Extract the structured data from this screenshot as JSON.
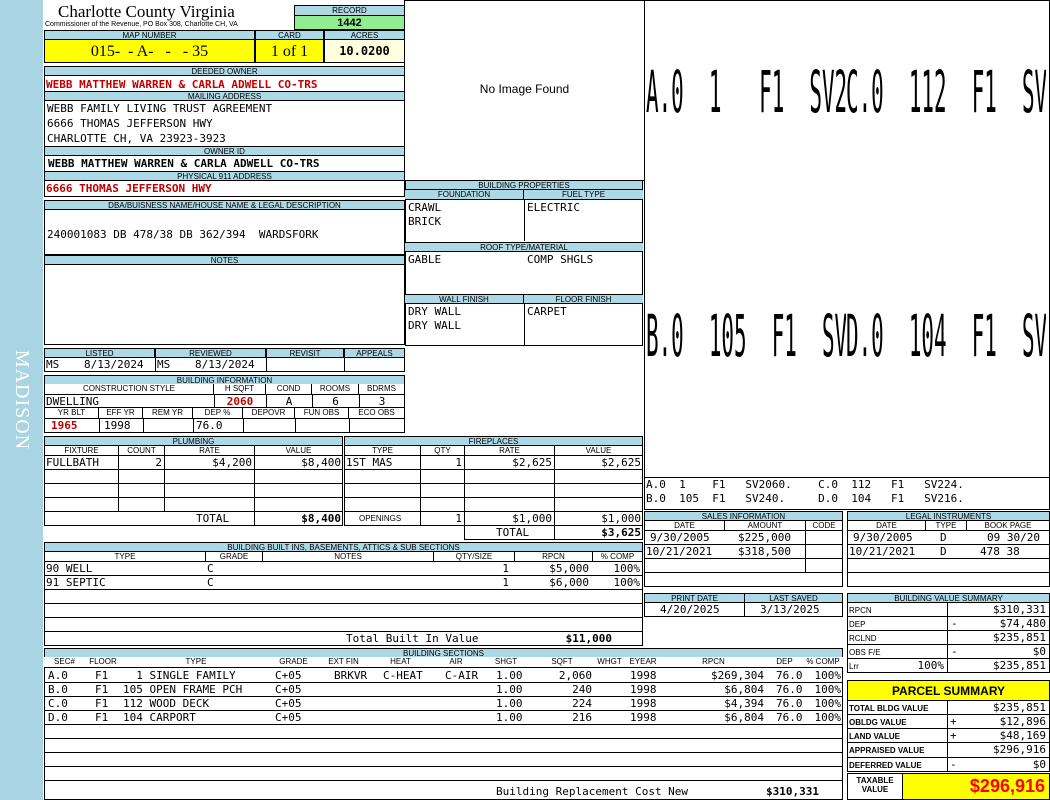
{
  "sidebar": {
    "district": "MADISON"
  },
  "county": {
    "title": "Charlotte County Virginia",
    "subtitle": "Commissioner of the Revenue, PO Box 308, Charlotte CH, VA"
  },
  "record": {
    "label": "RECORD",
    "value": "1442"
  },
  "map": {
    "map_label": "MAP NUMBER",
    "map_number": "015-  - A-   -   - 35",
    "card_label": "CARD",
    "card_value": "1 of 1",
    "acres_label": "ACRES",
    "acres_value": "10.0200"
  },
  "deeded_owner": {
    "label": "DEEDED OWNER",
    "value": "WEBB MATTHEW WARREN & CARLA ADWELL CO-TRS"
  },
  "mailing": {
    "label": "MAILING ADDRESS",
    "line1": "WEBB FAMILY LIVING TRUST AGREEMENT",
    "line2": "6666 THOMAS JEFFERSON HWY",
    "line3": "CHARLOTTE CH, VA 23923-3923"
  },
  "owner_id": {
    "label": "OWNER ID",
    "value": "WEBB MATTHEW WARREN & CARLA ADWELL CO-TRS"
  },
  "physical": {
    "label": "PHYSICAL 911 ADDRESS",
    "value": "6666 THOMAS JEFFERSON HWY"
  },
  "legal": {
    "label": "DBA/BUISNESS NAME/HOUSE NAME & LEGAL DESCRIPTION",
    "value": "240001083 DB 478/38 DB 362/394  WARDSFORK"
  },
  "notes": {
    "label": "NOTES",
    "value": ""
  },
  "photo": {
    "text": "No Image Found"
  },
  "listed": {
    "listed_label": "LISTED",
    "listed_by": "MS",
    "listed_date": "8/13/2024",
    "reviewed_label": "REVIEWED",
    "reviewed_by": "MS",
    "reviewed_date": "8/13/2024",
    "revisit_label": "REVISIT",
    "appeals_label": "APPEALS"
  },
  "building_info": {
    "label": "BUILDING INFORMATION",
    "h_style": "CONSTRUCTION STYLE",
    "h_sqft": "H SQFT",
    "h_cond": "COND",
    "h_rooms": "ROOMS",
    "h_bdrms": "BDRMS",
    "style": "DWELLING",
    "sqft": "2060",
    "cond": "A",
    "rooms": "6",
    "bdrms": "3",
    "h_yrblt": "YR BLT",
    "h_effyr": "EFF YR",
    "h_remyr": "REM YR",
    "h_dep": "DEP %",
    "h_depovr": "DEPOVR",
    "h_funobs": "FUN OBS",
    "h_ecoobs": "ECO OBS",
    "yrblt": "1965",
    "effyr": "1998",
    "remyr": "",
    "dep": "76.0",
    "depovr": "",
    "funobs": "",
    "ecoobs": ""
  },
  "building_props": {
    "label": "BUILDING PROPERTIES",
    "foundation_label": "FOUNDATION",
    "foundation_1": "CRAWL",
    "foundation_2": "BRICK",
    "fuel_label": "FUEL TYPE",
    "fuel": "ELECTRIC",
    "roof_label": "ROOF TYPE/MATERIAL",
    "roof_type": "GABLE",
    "roof_material": "COMP SHGLS",
    "wall_label": "WALL FINISH",
    "wall_1": "DRY WALL",
    "wall_2": "DRY WALL",
    "floor_label": "FLOOR FINISH",
    "floor": "CARPET"
  },
  "sketch": {
    "row1": [
      {
        "text": "A.0  1   F1  SV2060."
      },
      {
        "text": "C.0  112  F1  SV224."
      }
    ],
    "row2": [
      {
        "text": "B.0  105  F1  SV240."
      },
      {
        "text": "D.0  104  F1  SV216."
      }
    ],
    "legend_1": "A.0  1    F1   SV2060.    C.0  112   F1   SV224.",
    "legend_2": "B.0  105  F1   SV240.     D.0  104   F1   SV216."
  },
  "plumbing": {
    "label": "PLUMBING",
    "headers": [
      "FIXTURE",
      "COUNT",
      "RATE",
      "VALUE"
    ],
    "rows": [
      {
        "fixture": "FULLBATH",
        "count": "2",
        "rate": "$4,200",
        "value": "$8,400"
      }
    ],
    "total_label": "TOTAL",
    "total": "$8,400"
  },
  "fireplaces": {
    "label": "FIREPLACES",
    "headers": [
      "TYPE",
      "QTY",
      "RATE",
      "VALUE"
    ],
    "rows": [
      {
        "type": "1ST MAS",
        "qty": "1",
        "rate": "$2,625",
        "value": "$2,625"
      }
    ],
    "openings_label": "OPENINGS",
    "openings_qty": "1",
    "openings_rate": "$1,000",
    "openings_value": "$1,000",
    "total_label": "TOTAL",
    "total": "$3,625"
  },
  "sales": {
    "label": "SALES INFORMATION",
    "headers": [
      "DATE",
      "AMOUNT",
      "CODE"
    ],
    "rows": [
      {
        "date": "9/30/2005",
        "amount": "$225,000",
        "code": ""
      },
      {
        "date": "10/21/2021",
        "amount": "$318,500",
        "code": ""
      }
    ]
  },
  "legal_instruments": {
    "label": "LEGAL INSTRUMENTS",
    "headers": [
      "DATE",
      "TYPE",
      "BOOK PAGE"
    ],
    "rows": [
      {
        "date": "9/30/2005",
        "type": "D",
        "book": "09 30/20"
      },
      {
        "date": "10/21/2021",
        "type": "D",
        "book": "478 38"
      }
    ]
  },
  "print": {
    "print_label": "PRINT DATE",
    "print_date": "4/20/2025",
    "saved_label": "LAST SAVED",
    "saved_date": "3/13/2025"
  },
  "builtins": {
    "label": "BUILDING BUILT INS, BASEMENTS, ATTICS & SUB SECTIONS",
    "headers": [
      "TYPE",
      "GRADE",
      "NOTES",
      "QTY/SIZE",
      "RPCN",
      "% COMP"
    ],
    "rows": [
      {
        "type": "90 WELL",
        "grade": "C",
        "notes": "",
        "qty": "1",
        "rpcn": "$5,000",
        "comp": "100%"
      },
      {
        "type": "91 SEPTIC",
        "grade": "C",
        "notes": "",
        "qty": "1",
        "rpcn": "$6,000",
        "comp": "100%"
      }
    ],
    "total_label": "Total Built In Value",
    "total": "$11,000"
  },
  "value_summary": {
    "label": "BUILDING VALUE SUMMARY",
    "rows": [
      {
        "label": "RPCN",
        "sign": "",
        "value": "$310,331"
      },
      {
        "label": "DEP",
        "sign": "-",
        "value": "$74,480"
      },
      {
        "label": "RCLND",
        "sign": "",
        "value": "$235,851"
      },
      {
        "label": "OBS F/E",
        "sign": "-",
        "value": "$0"
      },
      {
        "label": "Lrr",
        "pct": "100%",
        "sign": "",
        "value": "$235,851"
      }
    ]
  },
  "sections": {
    "label": "BUILDING SECTIONS",
    "headers": [
      "SEC#",
      "FLOOR",
      "TYPE",
      "GRADE",
      "EXT FIN",
      "HEAT",
      "AIR",
      "SHGT",
      "SQFT",
      "WHGT",
      "EYEAR",
      "RPCN",
      "DEP",
      "% COMP"
    ],
    "rows": [
      {
        "sec": "A.0",
        "floor": "F1",
        "type": "  1 SINGLE FAMILY",
        "grade": "C+05",
        "ext": "BRKVR",
        "heat": "C-HEAT",
        "air": "C-AIR",
        "shgt": "1.00",
        "sqft": "2,060",
        "whgt": "",
        "eyear": "1998",
        "rpcn": "$269,304",
        "dep": "76.0",
        "comp": "100%"
      },
      {
        "sec": "B.0",
        "floor": "F1",
        "type": "105 OPEN FRAME PCH",
        "grade": "C+05",
        "ext": "",
        "heat": "",
        "air": "",
        "shgt": "1.00",
        "sqft": "240",
        "whgt": "",
        "eyear": "1998",
        "rpcn": "$6,804",
        "dep": "76.0",
        "comp": "100%"
      },
      {
        "sec": "C.0",
        "floor": "F1",
        "type": "112 WOOD DECK",
        "grade": "C+05",
        "ext": "",
        "heat": "",
        "air": "",
        "shgt": "1.00",
        "sqft": "224",
        "whgt": "",
        "eyear": "1998",
        "rpcn": "$4,394",
        "dep": "76.0",
        "comp": "100%"
      },
      {
        "sec": "D.0",
        "floor": "F1",
        "type": "104 CARPORT",
        "grade": "C+05",
        "ext": "",
        "heat": "",
        "air": "",
        "shgt": "1.00",
        "sqft": "216",
        "whgt": "",
        "eyear": "1998",
        "rpcn": "$6,804",
        "dep": "76.0",
        "comp": "100%"
      }
    ],
    "total_label": "Building Replacement Cost New",
    "total": "$310,331"
  },
  "parcel": {
    "label": "PARCEL SUMMARY",
    "rows": [
      {
        "label": "TOTAL BLDG VALUE",
        "sign": "",
        "value": "$235,851"
      },
      {
        "label": "OBLDG VALUE",
        "sign": "+",
        "value": "$12,896"
      },
      {
        "label": "LAND VALUE",
        "sign": "+",
        "value": "$48,169"
      },
      {
        "label": "APPRAISED VALUE",
        "sign": "",
        "value": "$296,916"
      },
      {
        "label": "DEFERRED VALUE",
        "sign": "-",
        "value": "$0"
      }
    ],
    "taxable_label_1": "TAXABLE",
    "taxable_label_2": "VALUE",
    "taxable_value": "$296,916"
  },
  "colors": {
    "header_blue": "#add8e6",
    "sidebar_blue": "#a9d4e3",
    "highlight_yellow": "#ffff00",
    "record_green": "#90ee90",
    "acres_cream": "#ffffe0",
    "value_red": "#c00000"
  }
}
